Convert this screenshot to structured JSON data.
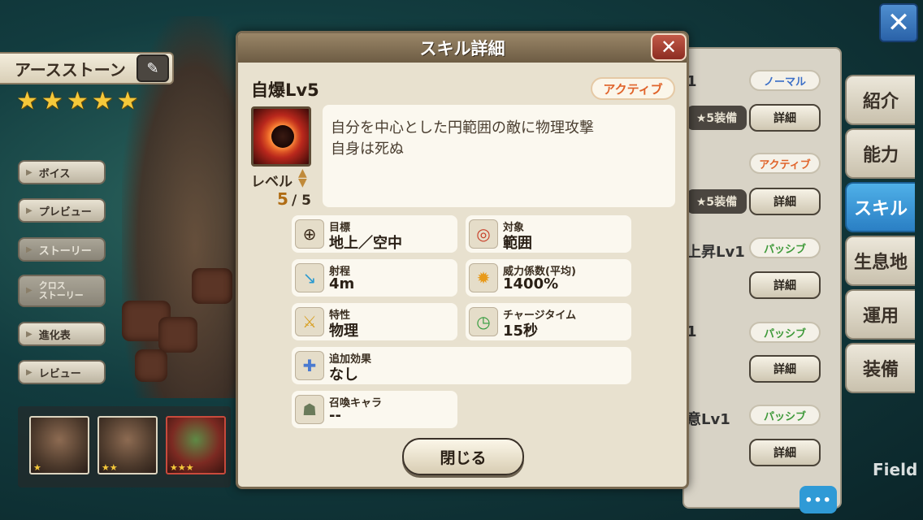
{
  "character": {
    "name": "アースストーン",
    "rarity": 5,
    "star_char": "★"
  },
  "side_menu": [
    {
      "label": "ボイス",
      "enabled": true
    },
    {
      "label": "プレビュー",
      "enabled": true
    },
    {
      "label": "ストーリー",
      "enabled": false
    },
    {
      "label": "クロス\nストーリー",
      "enabled": false
    },
    {
      "label": "進化表",
      "enabled": true
    },
    {
      "label": "レビュー",
      "enabled": true
    }
  ],
  "evolution_thumbs": [
    {
      "stars": "★"
    },
    {
      "stars": "★★"
    },
    {
      "stars": "★★★"
    }
  ],
  "skill_list": [
    {
      "name_partial": "1",
      "type": "ノーマル",
      "equip": "★5装備",
      "detail": "詳細"
    },
    {
      "name_partial": "",
      "type": "アクティブ",
      "equip": "★5装備",
      "detail": "詳細"
    },
    {
      "name_partial": "上昇Lv1",
      "type": "パッシブ",
      "detail": "詳細"
    },
    {
      "name_partial": "1",
      "type": "パッシブ",
      "detail": "詳細"
    },
    {
      "name_partial": "意Lv1",
      "type": "パッシブ",
      "detail": "詳細"
    }
  ],
  "tabs": [
    {
      "label": "紹介",
      "active": false
    },
    {
      "label": "能力",
      "active": false
    },
    {
      "label": "スキル",
      "active": true
    },
    {
      "label": "生息地",
      "active": false
    },
    {
      "label": "運用",
      "active": false
    },
    {
      "label": "装備",
      "active": false
    }
  ],
  "top_close_icon": "close-icon",
  "field_label": "Field",
  "chat_label": "•••",
  "modal": {
    "title": "スキル詳細",
    "close_symbol": "✕",
    "skill_name": "自爆Lv5",
    "skill_type": "アクティブ",
    "level_label": "レベル",
    "level_current": "5",
    "level_max": "/ 5",
    "description": [
      "自分を中心とした円範囲の敵に物理攻撃",
      "自身は死ぬ"
    ],
    "stats": {
      "target": {
        "label": "目標",
        "value": "地上／空中",
        "icon": "crosshair-icon"
      },
      "object": {
        "label": "対象",
        "value": "範囲",
        "icon": "area-target-icon"
      },
      "range": {
        "label": "射程",
        "value": "4m",
        "icon": "range-arrow-icon"
      },
      "power": {
        "label": "威力係数(平均)",
        "value": "1400%",
        "icon": "explosion-icon"
      },
      "attribute": {
        "label": "特性",
        "value": "物理",
        "icon": "sword-icon"
      },
      "charge": {
        "label": "チャージタイム",
        "value": "15秒",
        "icon": "clock-icon"
      },
      "extra": {
        "label": "追加効果",
        "value": "なし",
        "icon": "add-effect-icon"
      },
      "summon": {
        "label": "召喚キャラ",
        "value": "--",
        "icon": "summon-icon"
      }
    },
    "close_button": "閉じる"
  },
  "colors": {
    "active_tab": "#2a7fc4",
    "active_type": "#e0632a",
    "passive_type": "#3f9a3a",
    "normal_type": "#3b6fc7",
    "level_value": "#b06c14"
  }
}
